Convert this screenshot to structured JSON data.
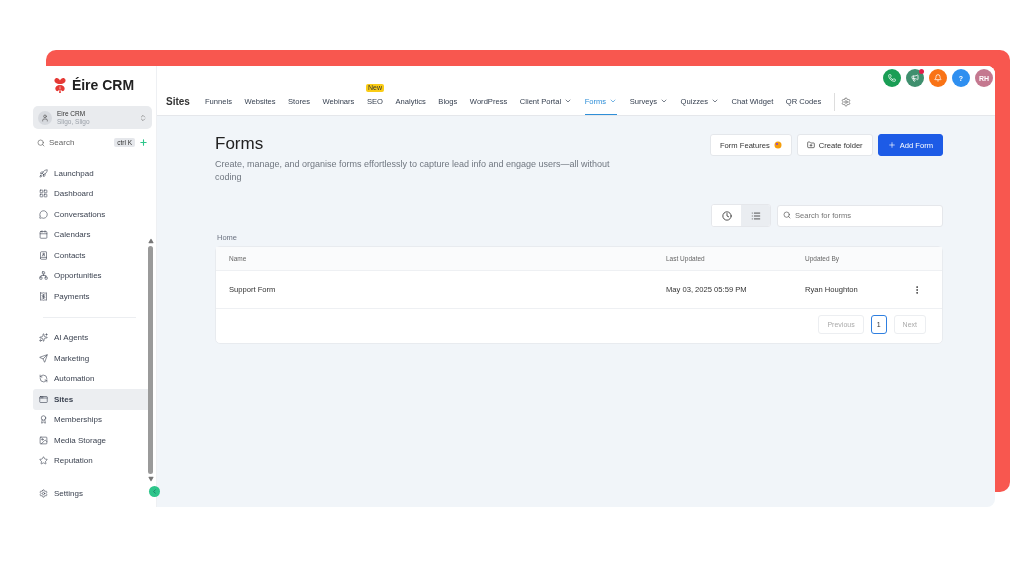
{
  "brand": {
    "name": "Éire CRM"
  },
  "account": {
    "name": "Eire CRM",
    "location": "Sligo, Sligo"
  },
  "sidebar_search": {
    "placeholder": "Search",
    "shortcut": "ctrl K"
  },
  "sidebar": {
    "groups": [
      [
        {
          "label": "Launchpad",
          "selected": false
        },
        {
          "label": "Dashboard",
          "selected": false
        },
        {
          "label": "Conversations",
          "selected": false
        },
        {
          "label": "Calendars",
          "selected": false
        },
        {
          "label": "Contacts",
          "selected": false
        },
        {
          "label": "Opportunities",
          "selected": false
        },
        {
          "label": "Payments",
          "selected": false
        }
      ],
      [
        {
          "label": "AI Agents",
          "selected": false
        },
        {
          "label": "Marketing",
          "selected": false
        },
        {
          "label": "Automation",
          "selected": false
        },
        {
          "label": "Sites",
          "selected": true
        },
        {
          "label": "Memberships",
          "selected": false
        },
        {
          "label": "Media Storage",
          "selected": false
        },
        {
          "label": "Reputation",
          "selected": false
        }
      ]
    ],
    "settings": {
      "label": "Settings"
    }
  },
  "header_actions": [
    {
      "kind": "phone",
      "color": "#1a9e55"
    },
    {
      "kind": "megaphone",
      "color": "#3f8f6e"
    },
    {
      "kind": "bell",
      "color": "#f97316"
    },
    {
      "kind": "help",
      "color": "#2f8ff0",
      "text": "?"
    },
    {
      "kind": "avatar",
      "color": "#c4788f",
      "text": "RH"
    }
  ],
  "topnav": {
    "title": "Sites",
    "tabs": [
      {
        "label": "Funnels",
        "selected": false,
        "dropdown": false
      },
      {
        "label": "Websites",
        "selected": false,
        "dropdown": false
      },
      {
        "label": "Stores",
        "selected": false,
        "dropdown": false
      },
      {
        "label": "Webinars",
        "selected": false,
        "dropdown": false
      },
      {
        "label": "SEO",
        "selected": false,
        "dropdown": false,
        "badge": "New"
      },
      {
        "label": "Analytics",
        "selected": false,
        "dropdown": false
      },
      {
        "label": "Blogs",
        "selected": false,
        "dropdown": false
      },
      {
        "label": "WordPress",
        "selected": false,
        "dropdown": false
      },
      {
        "label": "Client Portal",
        "selected": false,
        "dropdown": true
      },
      {
        "label": "Forms",
        "selected": true,
        "dropdown": true
      },
      {
        "label": "Surveys",
        "selected": false,
        "dropdown": true
      },
      {
        "label": "Quizzes",
        "selected": false,
        "dropdown": true
      },
      {
        "label": "Chat Widget",
        "selected": false,
        "dropdown": false
      },
      {
        "label": "QR Codes",
        "selected": false,
        "dropdown": false
      }
    ]
  },
  "page": {
    "title": "Forms",
    "description": "Create, manage, and organise forms effortlessly to capture lead info and engage users—all without coding",
    "buttons": [
      {
        "label": "Form Features",
        "kind": "features"
      },
      {
        "label": "Create folder",
        "kind": "folder"
      },
      {
        "label": "Add Form",
        "kind": "primary"
      }
    ]
  },
  "view_toggle": [
    {
      "kind": "recent",
      "selected": false
    },
    {
      "kind": "list",
      "selected": true
    }
  ],
  "search": {
    "placeholder": "Search for forms"
  },
  "breadcrumb": "Home",
  "table": {
    "columns": [
      "Name",
      "Last Updated",
      "Updated By"
    ],
    "rows": [
      {
        "name": "Support Form",
        "updated": "May 03, 2025 05:59 PM",
        "by": "Ryan Houghton"
      }
    ]
  },
  "pagination": {
    "previous": "Previous",
    "pages": [
      {
        "label": "1",
        "selected": true
      }
    ],
    "next": "Next"
  }
}
